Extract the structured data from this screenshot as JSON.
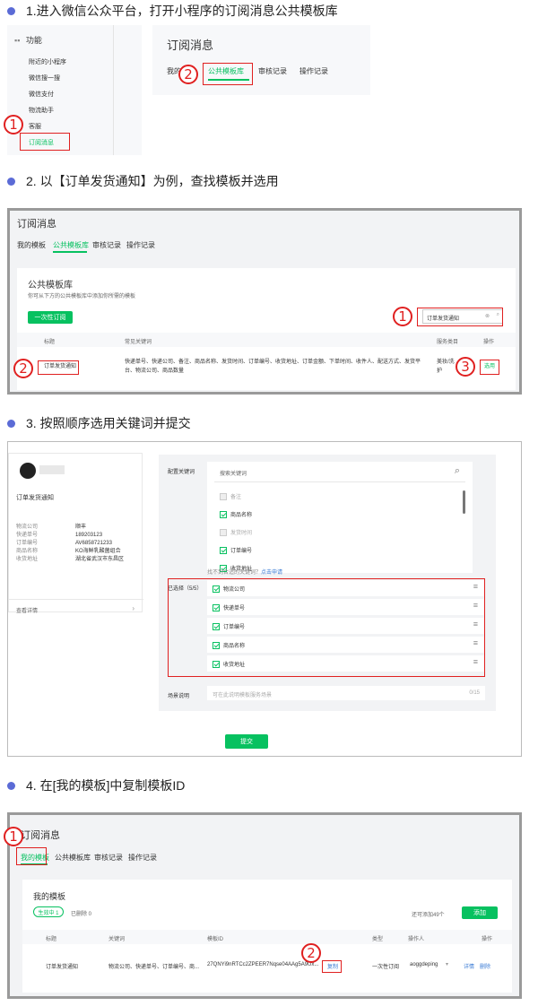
{
  "steps": [
    {
      "title": "1.进入微信公众平台，打开小程序的订阅消息公共模板库"
    },
    {
      "title": "2. 以【订单发货通知】为例，查找模板并选用"
    },
    {
      "title": "3. 按照顺序选用关键词并提交"
    },
    {
      "title": "4. 在[我的模板]中复制模板ID"
    }
  ],
  "step1": {
    "sidebar_header": "功能",
    "sidebar_items": [
      "附近的小程序",
      "微信搜一搜",
      "微信支付",
      "物流助手",
      "客服",
      "订阅消息"
    ],
    "panel_title": "订阅消息",
    "tabs": [
      "我的",
      "公共模板库",
      "审核记录",
      "操作记录"
    ],
    "badges": [
      "1",
      "2"
    ]
  },
  "step2": {
    "header": "订阅消息",
    "tabs": [
      "我的模板",
      "公共模板库",
      "审核记录",
      "操作记录"
    ],
    "lib_title": "公共模板库",
    "lib_desc": "你可从下方的公共模板库中添加你所需的模板",
    "once_btn": "一次性订阅",
    "search_value": "订单发货通知",
    "col_title": "标题",
    "col_keywords": "常见关键词",
    "col_category": "服务类目",
    "col_action": "操作",
    "row_title": "订单发货通知",
    "row_keywords": "快递单号、快递公司、备注、商品名称、发货时间、订单编号、收货地址、订单金额、下单时间、收件人、配送方式、发货平台、物流公司、商品数量",
    "row_category": "美妆/洗护",
    "row_action": "选用",
    "badges": [
      "1",
      "2",
      "3"
    ]
  },
  "step3": {
    "preview_title": "订单发货通知",
    "preview_fields": [
      {
        "label": "物流公司",
        "value": "顺丰"
      },
      {
        "label": "快递单号",
        "value": "189203123"
      },
      {
        "label": "订单编号",
        "value": "AV6858721233"
      },
      {
        "label": "商品名称",
        "value": "KO海鲜乳酸菌组合"
      },
      {
        "label": "收货地址",
        "value": "湖北省武汉市东昌区"
      }
    ],
    "preview_link": "查看详情",
    "config_label": "配置关键词",
    "search_placeholder": "搜索关键词",
    "options": [
      {
        "label": "备注",
        "checked": false
      },
      {
        "label": "商品名称",
        "checked": true
      },
      {
        "label": "发货时间",
        "checked": false
      },
      {
        "label": "订单编号",
        "checked": true
      },
      {
        "label": "收货地址",
        "checked": true
      }
    ],
    "not_found": "找不到合适的关键词？",
    "apply_link": "点击申请",
    "selected_label": "已选择（5/5）",
    "selected": [
      "物流公司",
      "快递单号",
      "订单编号",
      "商品名称",
      "收货地址"
    ],
    "scene_label": "场景说明",
    "scene_placeholder": "可在此说明模板服务场景",
    "scene_count": "0/15",
    "submit": "提交"
  },
  "step4": {
    "header": "订阅消息",
    "tabs": [
      "我的模板",
      "公共模板库",
      "审核记录",
      "操作记录"
    ],
    "section_title": "我的模板",
    "filter_active": "生效中 1",
    "filter_deleted": "已删除 0",
    "can_add": "还可添加49个",
    "add_btn": "添加",
    "cols": [
      "标题",
      "关键词",
      "模板ID",
      "类型",
      "操作人",
      "操作"
    ],
    "row": {
      "title": "订单发货通知",
      "keywords": "物流公司、快递单号、订单编号、商...",
      "template_id": "27QNYi9nRTCc2ZPEER7Nqse04AAg5A9Ux...",
      "copy": "复制",
      "type": "一次性订阅",
      "operator": "aoggdeping",
      "detail": "详情",
      "delete": "删除"
    },
    "badges": [
      "1",
      "2"
    ]
  }
}
